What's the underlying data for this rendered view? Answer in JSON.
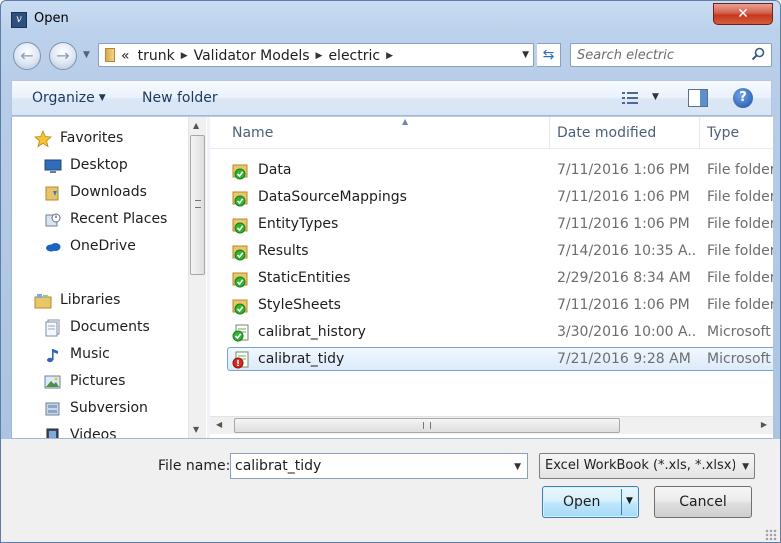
{
  "window": {
    "title": "Open",
    "close_label": "✕"
  },
  "navigation": {
    "breadcrumbs": [
      "trunk",
      "Validator Models",
      "electric"
    ],
    "overflow_label": "«",
    "search_placeholder": "Search electric"
  },
  "toolbar": {
    "organize_label": "Organize",
    "new_folder_label": "New folder",
    "help_label": "?"
  },
  "nav_pane": {
    "favorites": {
      "label": "Favorites",
      "items": [
        {
          "label": "Desktop",
          "icon": "desktop-icon"
        },
        {
          "label": "Downloads",
          "icon": "downloads-icon"
        },
        {
          "label": "Recent Places",
          "icon": "recent-places-icon"
        },
        {
          "label": "OneDrive",
          "icon": "onedrive-icon"
        }
      ]
    },
    "libraries": {
      "label": "Libraries",
      "items": [
        {
          "label": "Documents",
          "icon": "documents-icon"
        },
        {
          "label": "Music",
          "icon": "music-icon"
        },
        {
          "label": "Pictures",
          "icon": "pictures-icon"
        },
        {
          "label": "Subversion",
          "icon": "subversion-icon"
        },
        {
          "label": "Videos",
          "icon": "videos-icon"
        }
      ]
    }
  },
  "file_list": {
    "columns": {
      "name": "Name",
      "date": "Date modified",
      "type": "Type"
    },
    "sort_indicator": "▲",
    "rows": [
      {
        "name": "Data",
        "date": "7/11/2016 1:06 PM",
        "type": "File folder",
        "icon": "svn-folder-icon",
        "selected": false
      },
      {
        "name": "DataSourceMappings",
        "date": "7/11/2016 1:06 PM",
        "type": "File folder",
        "icon": "svn-folder-icon",
        "selected": false
      },
      {
        "name": "EntityTypes",
        "date": "7/11/2016 1:06 PM",
        "type": "File folder",
        "icon": "svn-folder-icon",
        "selected": false
      },
      {
        "name": "Results",
        "date": "7/14/2016 10:35 A...",
        "type": "File folder",
        "icon": "svn-folder-icon",
        "selected": false
      },
      {
        "name": "StaticEntities",
        "date": "2/29/2016 8:34 AM",
        "type": "File folder",
        "icon": "svn-folder-icon",
        "selected": false
      },
      {
        "name": "StyleSheets",
        "date": "7/11/2016 1:06 PM",
        "type": "File folder",
        "icon": "svn-folder-icon",
        "selected": false
      },
      {
        "name": "calibrat_history",
        "date": "3/30/2016 10:00 A...",
        "type": "Microsoft",
        "icon": "excel-svn-ok-icon",
        "selected": false
      },
      {
        "name": "calibrat_tidy",
        "date": "7/21/2016 9:28 AM",
        "type": "Microsoft",
        "icon": "excel-svn-modified-icon",
        "selected": true
      }
    ]
  },
  "footer": {
    "file_name_label": "File name:",
    "file_name_value": "calibrat_tidy",
    "file_type_value": "Excel WorkBook (*.xls, *.xlsx)",
    "open_label": "Open",
    "cancel_label": "Cancel"
  },
  "colors": {
    "selection_border": "#7da2ce",
    "svn_ok": "#2db52d",
    "svn_modified": "#d9281c"
  }
}
